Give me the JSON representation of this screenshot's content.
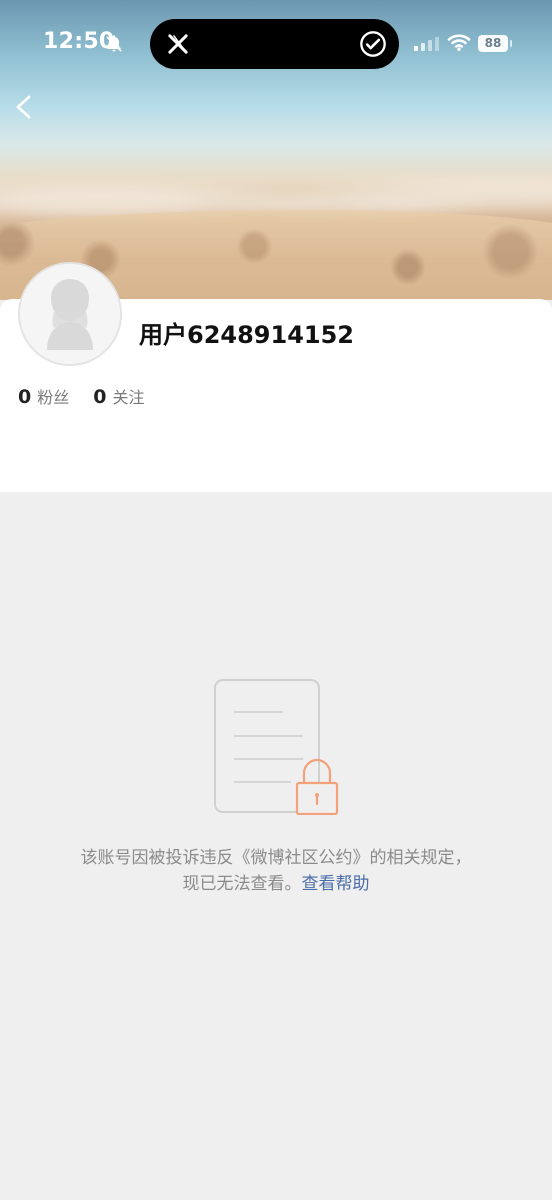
{
  "status_bar": {
    "time": "12:50",
    "battery": "88",
    "icons": [
      "bell-off-icon",
      "x-logo-icon",
      "check-circle-icon",
      "signal-icon",
      "wifi-icon",
      "battery-icon"
    ]
  },
  "header": {
    "back_icon": "chevron-left-icon"
  },
  "profile": {
    "username": "用户6248914152",
    "stats": [
      {
        "value": "0",
        "label": "粉丝"
      },
      {
        "value": "0",
        "label": "关注"
      }
    ],
    "avatar_icon": "default-avatar-icon"
  },
  "empty_state": {
    "illustration": "locked-document-icon",
    "line1": "该账号因被投诉违反《微博社区公约》的相关规定，",
    "line2_prefix": "现已无法查看。",
    "help_link": "查看帮助"
  },
  "colors": {
    "link": "#4a6ea8",
    "lock": "#f2a17a",
    "background": "#efefef"
  }
}
